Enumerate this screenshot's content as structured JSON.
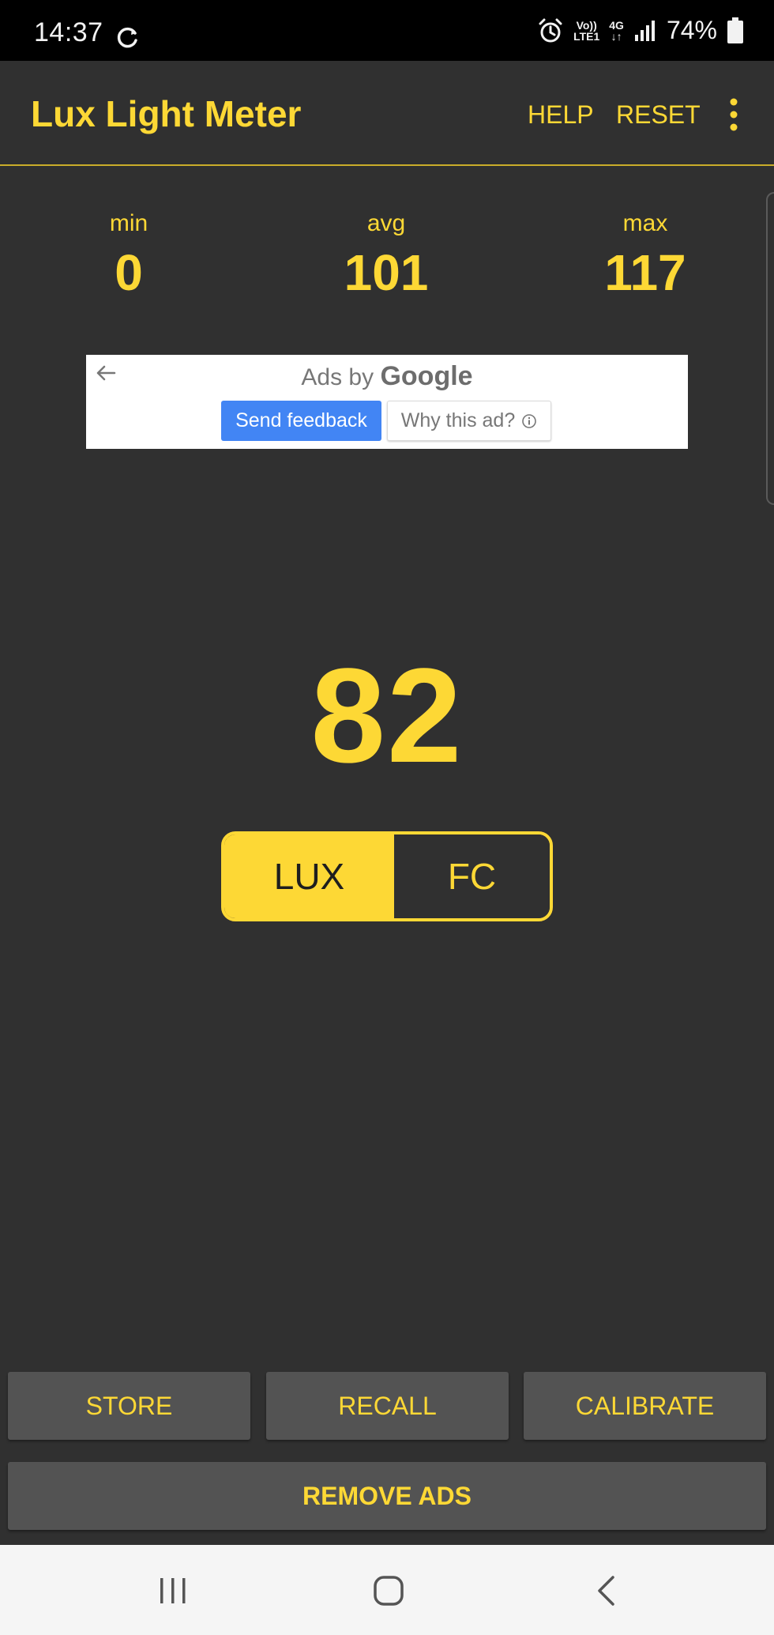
{
  "status_bar": {
    "time": "14:37",
    "network_top": "Vo))",
    "network_bottom": "LTE1",
    "data_type": "4G",
    "battery": "74%",
    "icons": [
      "sync-icon",
      "alarm-icon",
      "signal-icon",
      "battery-icon"
    ]
  },
  "app_bar": {
    "title": "Lux Light Meter",
    "help_label": "HELP",
    "reset_label": "RESET",
    "overflow_icon": "more-vert-icon"
  },
  "stats": {
    "min_label": "min",
    "min_value": "0",
    "avg_label": "avg",
    "avg_value": "101",
    "max_label": "max",
    "max_value": "117"
  },
  "ad": {
    "prefix": "Ads by ",
    "brand": "Google",
    "feedback_label": "Send feedback",
    "why_label": "Why this ad?"
  },
  "reading": {
    "value": "82"
  },
  "unit_toggle": {
    "lux_label": "LUX",
    "fc_label": "FC",
    "selected": "LUX"
  },
  "buttons": {
    "store": "STORE",
    "recall": "RECALL",
    "calibrate": "CALIBRATE",
    "remove_ads": "REMOVE ADS"
  },
  "colors": {
    "accent": "#fdd835",
    "background": "#303030",
    "button_bg": "#535353"
  }
}
